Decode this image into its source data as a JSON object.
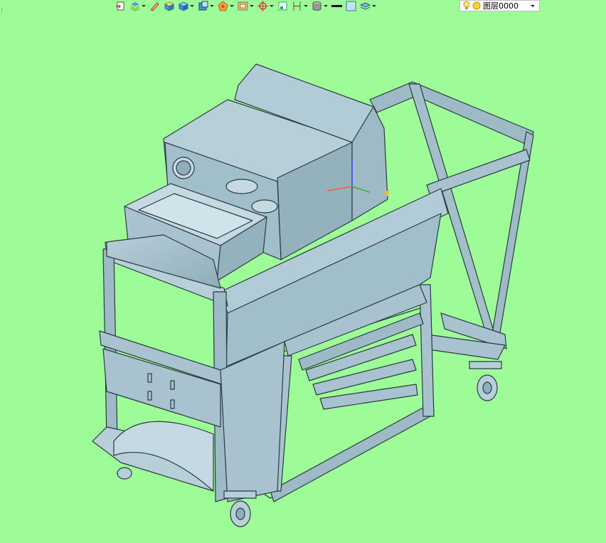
{
  "viewport": {
    "background": "#9dfc97"
  },
  "toolbar": {
    "icons": [
      "import-icon",
      "layers-stack-icon",
      "pen-icon",
      "cube-yellow-icon",
      "cube-blue-icon",
      "cube-view-icon",
      "shading-icon",
      "frame-icon",
      "snap-icon",
      "grid-icon",
      "dimension-icon",
      "material-icon",
      "line-color-icon",
      "fill-color-icon",
      "layer-manager-icon"
    ],
    "line_color": "#000000",
    "fill_color": "#c6e3f5"
  },
  "layer_select": {
    "value": "图层0000"
  },
  "corner_mark": ":",
  "model": {
    "body_color": "#a8c3cf",
    "edge_color": "#2b3a40"
  }
}
